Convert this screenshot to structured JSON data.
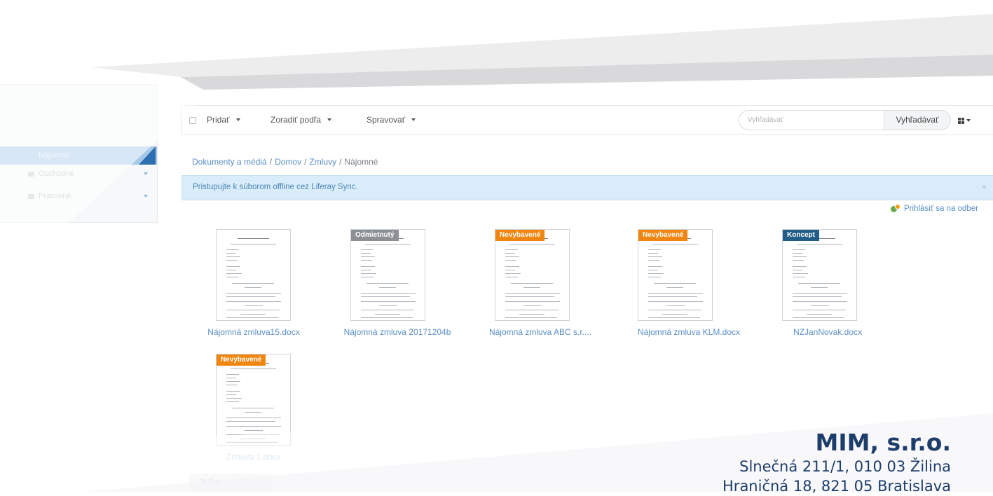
{
  "sidebar": {
    "items": [
      {
        "label": "Nájomné",
        "active": true
      },
      {
        "label": "Obchodné",
        "active": false
      },
      {
        "label": "Pracovné",
        "active": false
      }
    ]
  },
  "toolbar": {
    "add_label": "Pridať",
    "sort_label": "Zoradiť podľa",
    "manage_label": "Spravovať",
    "search_placeholder": "Vyhľadávať",
    "search_button": "Vyhľadávať",
    "view_icon": "grid-icon"
  },
  "breadcrumb": [
    "Dokumenty a médiá",
    "Domov",
    "Zmluvy",
    "Nájomné"
  ],
  "alert": {
    "text": "Pristupujte k súborom offline cez Liferay Sync.",
    "close": "×"
  },
  "subscribe": {
    "label": "Prihlásiť sa na odber"
  },
  "documents": [
    {
      "title": "Nájomná zmluva15.docx",
      "badge": ""
    },
    {
      "title": "Nájomná zmluva 20171204b",
      "badge": "Odmietnutý",
      "badge_color": "#8c9094"
    },
    {
      "title": "Nájomná zmluva ABC s.r....",
      "badge": "Nevybavené",
      "badge_color": "#f0850f"
    },
    {
      "title": "Nájomná zmluva KLM.docx",
      "badge": "Nevybavené",
      "badge_color": "#f0850f"
    },
    {
      "title": "NZJanNovak.docx",
      "badge": "Koncept",
      "badge_color": "#215d86"
    },
    {
      "title": "Zmluva 1.docx",
      "badge": "Nevybavené",
      "badge_color": "#f0850f"
    }
  ],
  "footer": {
    "label": "20 Pol..."
  },
  "company": {
    "name": "MIM, s.r.o.",
    "address_1": "Slnečná 211/1, 010 03  Žilina",
    "address_2": "Hraničná 18, 821 05 Bratislava"
  },
  "colors": {
    "link": "#5a8fc6",
    "alert_bg": "#d8ecf9",
    "company_text": "#1d3d6b",
    "badge_orange": "#f0850f",
    "badge_gray": "#8c9094",
    "badge_blue": "#215d86"
  }
}
